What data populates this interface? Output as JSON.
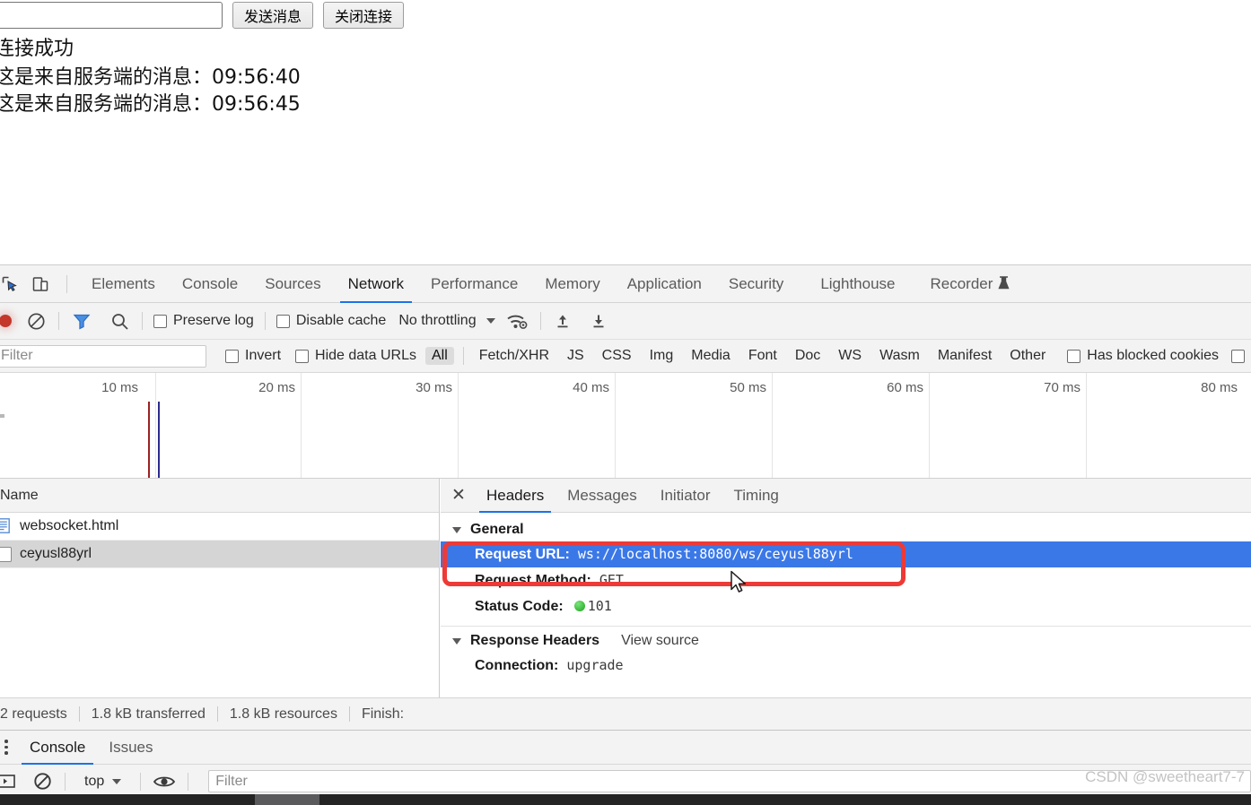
{
  "page": {
    "message_input_value": "",
    "message_input_placeholder": "",
    "send_button_label": "发送消息",
    "close_button_label": "关闭连接",
    "log_lines": [
      "连接成功",
      "这是来自服务端的消息：09:56:40",
      "这是来自服务端的消息：09:56:45"
    ]
  },
  "devtools": {
    "main_tabs": [
      {
        "label": "Elements",
        "active": false
      },
      {
        "label": "Console",
        "active": false
      },
      {
        "label": "Sources",
        "active": false
      },
      {
        "label": "Network",
        "active": true
      },
      {
        "label": "Performance",
        "active": false
      },
      {
        "label": "Memory",
        "active": false
      },
      {
        "label": "Application",
        "active": false
      },
      {
        "label": "Security",
        "active": false
      },
      {
        "label": "Lighthouse",
        "active": false
      },
      {
        "label": "Recorder",
        "active": false,
        "badge": "flask-icon"
      }
    ],
    "network_toolbar": {
      "record_tooltip": "record-button",
      "preserve_log_label": "Preserve log",
      "preserve_log_checked": false,
      "disable_cache_label": "Disable cache",
      "disable_cache_checked": false,
      "throttling_value": "No throttling"
    },
    "filter_bar": {
      "filter_placeholder": "Filter",
      "filter_value": "",
      "invert_label": "Invert",
      "invert_checked": false,
      "hide_data_urls_label": "Hide data URLs",
      "hide_data_urls_checked": false,
      "types": [
        {
          "label": "All",
          "selected": true
        },
        {
          "label": "Fetch/XHR",
          "selected": false
        },
        {
          "label": "JS",
          "selected": false
        },
        {
          "label": "CSS",
          "selected": false
        },
        {
          "label": "Img",
          "selected": false
        },
        {
          "label": "Media",
          "selected": false
        },
        {
          "label": "Font",
          "selected": false
        },
        {
          "label": "Doc",
          "selected": false
        },
        {
          "label": "WS",
          "selected": false
        },
        {
          "label": "Wasm",
          "selected": false
        },
        {
          "label": "Manifest",
          "selected": false
        },
        {
          "label": "Other",
          "selected": false
        }
      ],
      "has_blocked_cookies_label": "Has blocked cookies",
      "has_blocked_cookies_checked": false
    },
    "overview": {
      "tick_labels": [
        "10 ms",
        "20 ms",
        "30 ms",
        "40 ms",
        "50 ms",
        "60 ms",
        "70 ms",
        "80 ms"
      ],
      "marker_colors": {
        "dom_content_loaded": "#9b2323",
        "load": "#2b2b8f"
      }
    },
    "requests_pane": {
      "column_header": "Name",
      "rows": [
        {
          "name": "websocket.html",
          "icon": "document-icon",
          "selected": false
        },
        {
          "name": "ceyusl88yrl",
          "icon": "websocket-icon",
          "selected": true
        }
      ]
    },
    "details_pane": {
      "tabs": [
        {
          "label": "Headers",
          "active": true
        },
        {
          "label": "Messages",
          "active": false
        },
        {
          "label": "Initiator",
          "active": false
        },
        {
          "label": "Timing",
          "active": false
        }
      ],
      "general": {
        "section_label": "General",
        "rows": [
          {
            "key": "Request URL:",
            "value": "ws://localhost:8080/ws/ceyusl88yrl",
            "highlighted": true
          },
          {
            "key": "Request Method:",
            "value": "GET",
            "highlighted": false
          },
          {
            "key": "Status Code:",
            "value": "101",
            "highlighted": false,
            "status_dot": "green"
          }
        ]
      },
      "response_headers": {
        "section_label": "Response Headers",
        "view_source_label": "View source",
        "rows": [
          {
            "key": "Connection:",
            "value": "upgrade"
          }
        ]
      }
    },
    "status_bar": {
      "requests": "2 requests",
      "transferred": "1.8 kB transferred",
      "resources": "1.8 kB resources",
      "finish": "Finish:"
    },
    "drawer": {
      "tabs": [
        {
          "label": "Console",
          "active": true
        },
        {
          "label": "Issues",
          "active": false
        }
      ],
      "context_value": "top",
      "filter_placeholder": "Filter",
      "filter_value": ""
    }
  },
  "annotation": {
    "highlight_color": "#ee3a36",
    "selection_color": "#3b78e7"
  },
  "watermark": "CSDN @sweetheart7-7"
}
